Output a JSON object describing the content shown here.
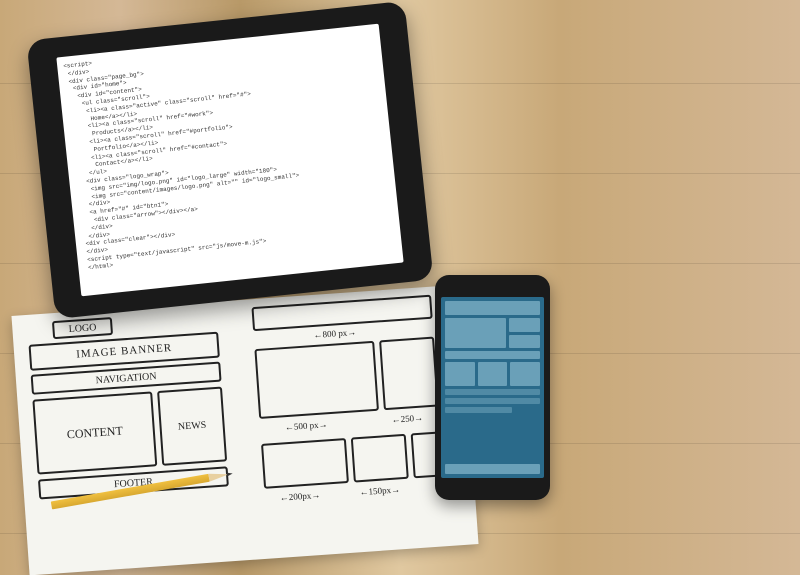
{
  "tablet": {
    "code": "<script>\n </div>\n <div class=\"page_bg\">\n  <div id=\"home\">\n   <div id=\"content\">\n    <ul class=\"scroll\">\n     <li><a class=\"active\" class=\"scroll\" href=\"#\">\n      Home</a></li>\n     <li><a class=\"scroll\" href=\"#work\">\n      Products</a></li>\n     <li><a class=\"scroll\" href=\"#portfolio\">\n      Portfolio</a></li>\n     <li><a class=\"scroll\" href=\"#contact\">\n      Contact</a></li>\n    </ul>\n   <div class=\"logo_wrap\">\n    <img src=\"img/logo.png\" id=\"logo_large\" width=\"180\">\n    <img src=\"content/images/logo.png\" alt=\"\" id=\"logo_small\">\n   </div>\n   <a href=\"#\" id=\"btn1\">\n    <div class=\"arrow\"></div></a>\n   </div>\n  </div>\n <div class=\"clear\"></div>\n </div>\n <script type=\"text/javascript\" src=\"js/move-m.js\">\n </html>"
  },
  "wireframe": {
    "logo": "LOGO",
    "banner": "IMAGE BANNER",
    "nav": "NAVIGATION",
    "content": "CONTENT",
    "news": "NEWS",
    "footer": "FOOTER",
    "width_full": "800 px",
    "width_content": "500 px",
    "width_side": "250",
    "width_small": "200px",
    "width_smaller": "150px",
    "side_label": "500px"
  }
}
